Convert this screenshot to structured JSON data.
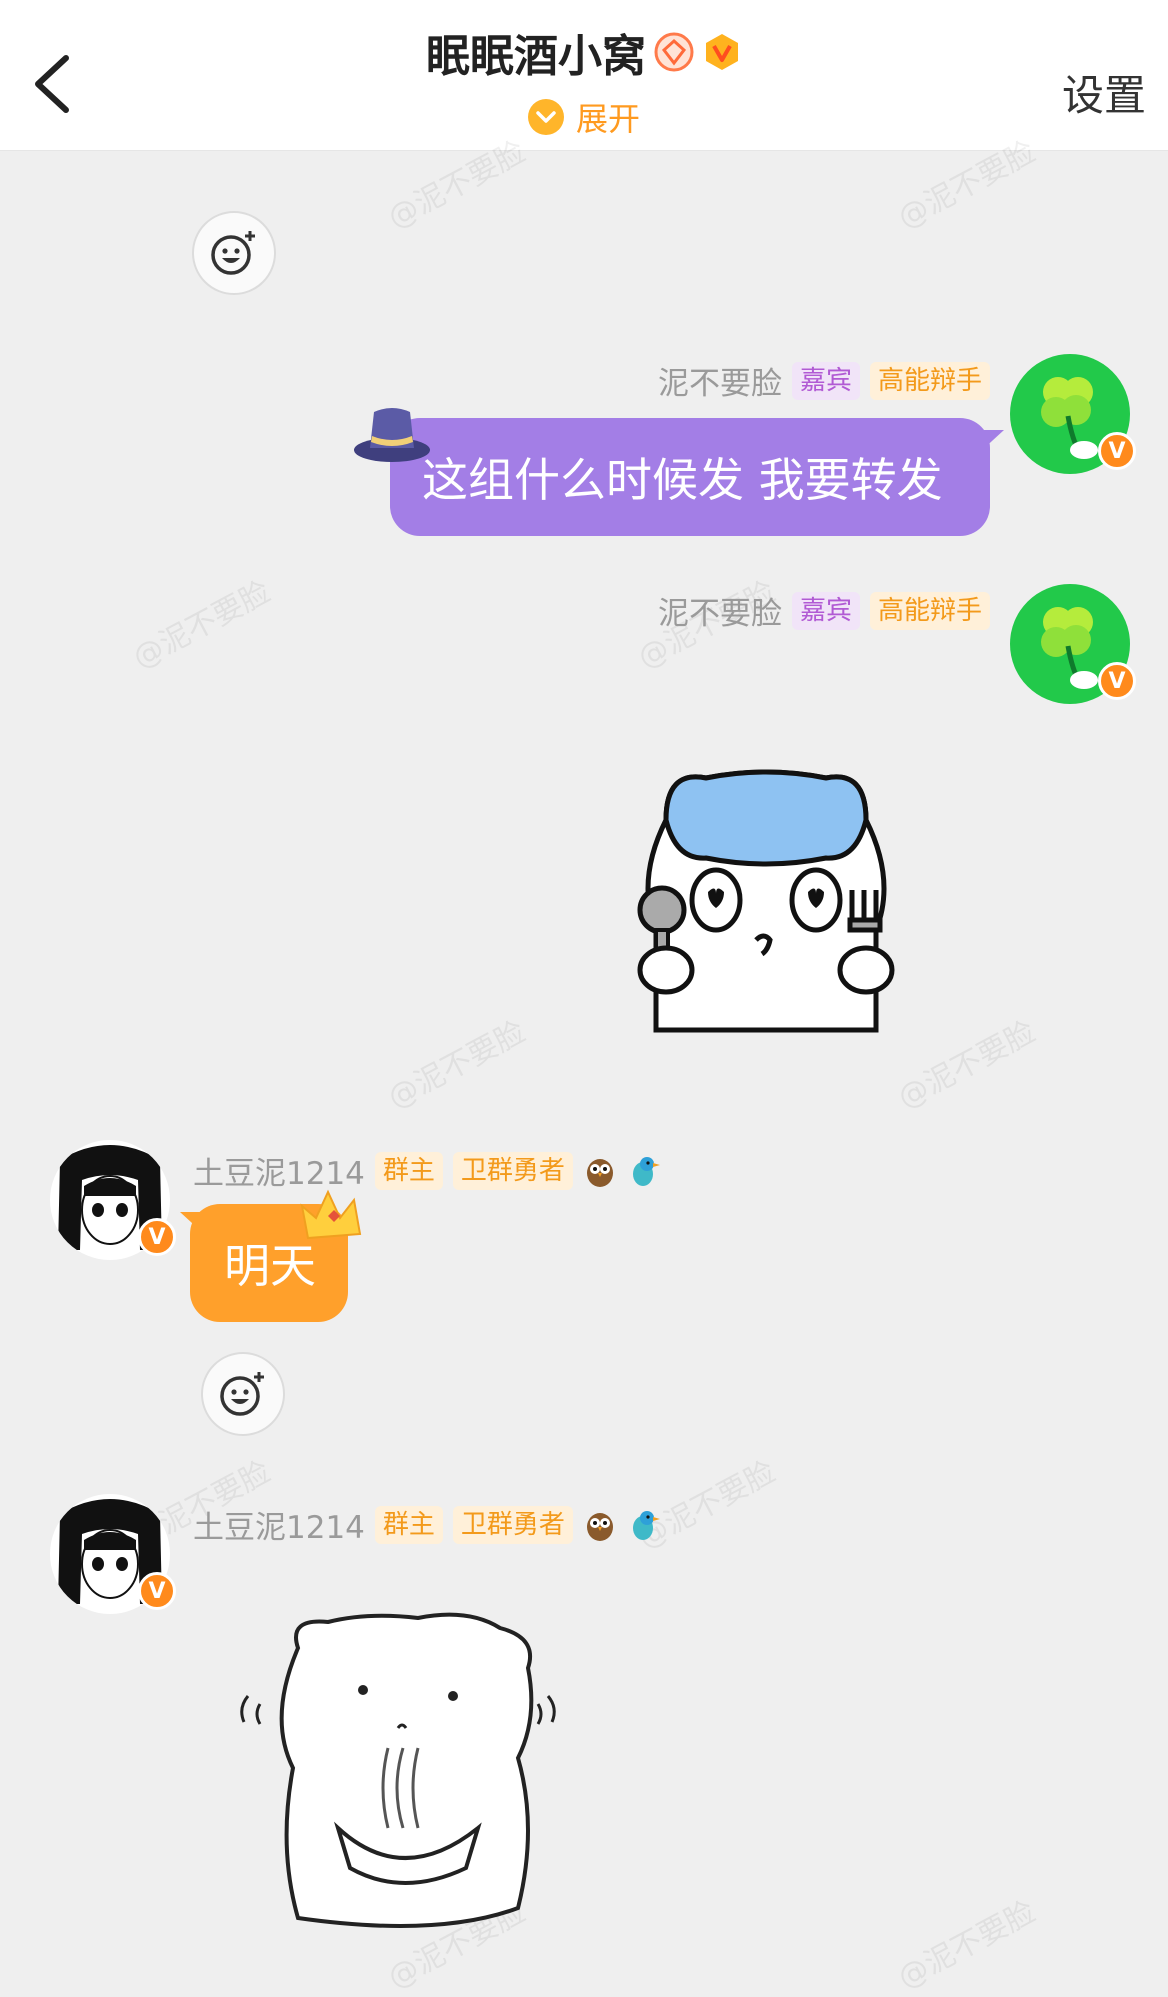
{
  "header": {
    "title": "眠眠酒小窝",
    "expand_label": "展开",
    "settings_label": "设置"
  },
  "watermark": "@泥不要脸",
  "messages": [
    {
      "sender": "泥不要脸",
      "tags": [
        "嘉宾",
        "高能辩手"
      ],
      "text": "这组什么时候发 我要转发"
    },
    {
      "sender": "泥不要脸",
      "tags": [
        "嘉宾",
        "高能辩手"
      ],
      "sticker": "hamster-with-spoon-fork"
    },
    {
      "sender": "土豆泥1214",
      "tags": [
        "群主",
        "卫群勇者"
      ],
      "text": "明天"
    },
    {
      "sender": "土豆泥1214",
      "tags": [
        "群主",
        "卫群勇者"
      ],
      "sticker": "hamster-eating-noodles"
    }
  ],
  "colors": {
    "purple_bubble": "#a37ee6",
    "orange_bubble": "#ffa02b",
    "accent": "#ff9a1f"
  }
}
